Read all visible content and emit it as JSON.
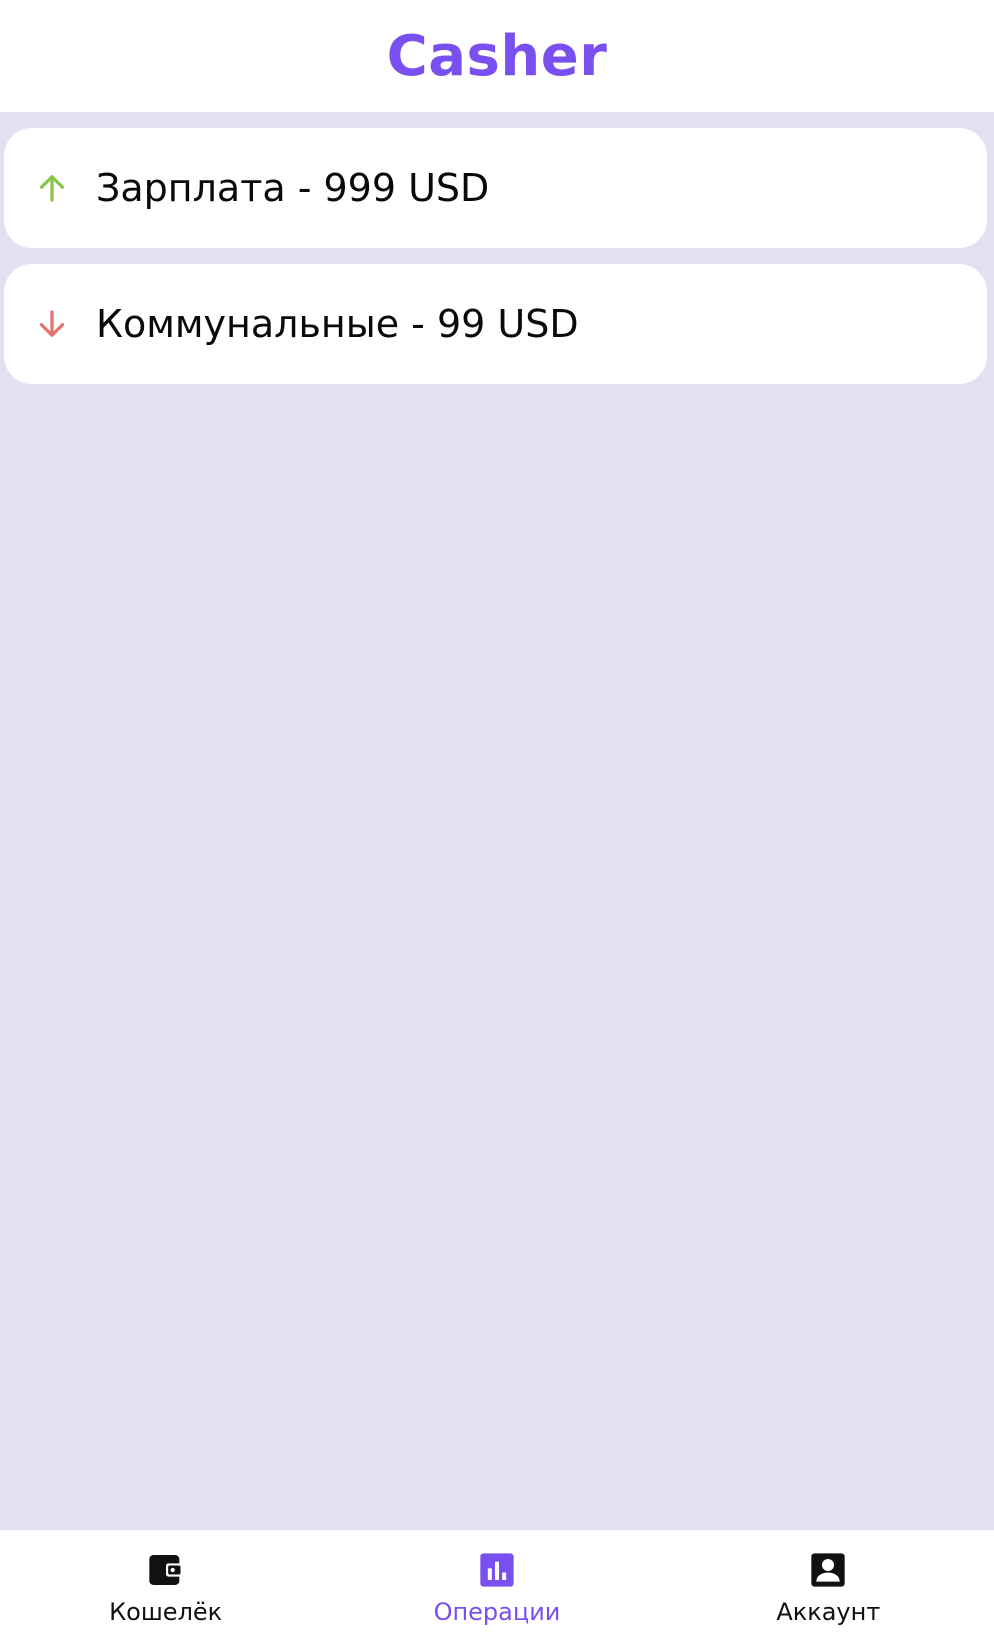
{
  "header": {
    "title": "Casher"
  },
  "operations": [
    {
      "label": "Зарплата - 999 USD",
      "direction": "income",
      "icon": "arrow-up-icon",
      "color": "#8bc34a"
    },
    {
      "label": "Коммунальные - 99 USD",
      "direction": "expense",
      "icon": "arrow-down-icon",
      "color": "#e57373"
    }
  ],
  "nav": {
    "items": [
      {
        "label": "Кошелёк",
        "icon": "wallet-icon",
        "active": false
      },
      {
        "label": "Операции",
        "icon": "chart-icon",
        "active": true
      },
      {
        "label": "Аккаунт",
        "icon": "account-icon",
        "active": false
      }
    ]
  },
  "colors": {
    "accent": "#7a4ff0",
    "background": "#e4e0f0",
    "income": "#8bc34a",
    "expense": "#e57373"
  }
}
